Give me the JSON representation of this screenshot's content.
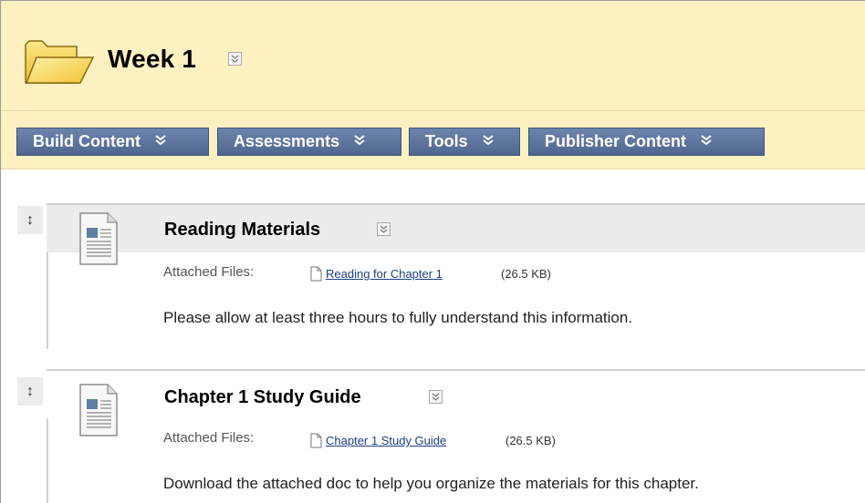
{
  "header": {
    "title": "Week 1",
    "icon": "folder-icon",
    "colors": {
      "background": "#fdf0c1",
      "button": "#5b7199"
    }
  },
  "action_bar": {
    "buttons": [
      {
        "label": "Build Content"
      },
      {
        "label": "Assessments"
      },
      {
        "label": "Tools"
      },
      {
        "label": "Publisher Content"
      }
    ]
  },
  "items": [
    {
      "title": "Reading Materials",
      "attached_label": "Attached Files:",
      "file_name": "Reading for Chapter 1",
      "file_size": "(26.5 KB)",
      "description": "Please allow at least three hours to fully understand this information."
    },
    {
      "title": "Chapter 1 Study Guide",
      "attached_label": "Attached Files:",
      "file_name": "Chapter 1 Study Guide",
      "file_size": "(26.5 KB)",
      "description": "Download the attached doc to help you organize the materials for this chapter."
    }
  ],
  "handle_glyph": "↕"
}
